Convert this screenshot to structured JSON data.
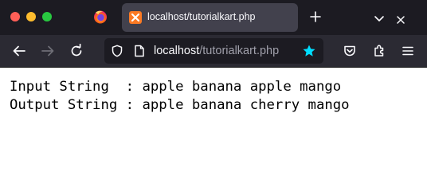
{
  "window": {
    "controls": [
      "close",
      "minimize",
      "zoom"
    ]
  },
  "browser_icon": "firefox-icon",
  "tab": {
    "favicon": "xampp-icon",
    "title": "localhost/tutorialkart.php"
  },
  "toolbar": {
    "buttons": [
      "back-icon",
      "forward-icon",
      "reload-icon",
      "pocket-icon",
      "extensions-icon",
      "menu-icon"
    ]
  },
  "urlbar": {
    "host": "localhost",
    "path": "/tutorialkart.php",
    "bookmarked": true
  },
  "colors": {
    "tab_strip": "#1c1b22",
    "toolbar": "#2b2a33",
    "active_tab": "#42414d",
    "accent_star": "#00ddff",
    "favicon_orange": "#fb7a24"
  },
  "page": {
    "lines": [
      "Input String  : apple banana apple mango",
      "Output String : apple banana cherry mango"
    ]
  }
}
